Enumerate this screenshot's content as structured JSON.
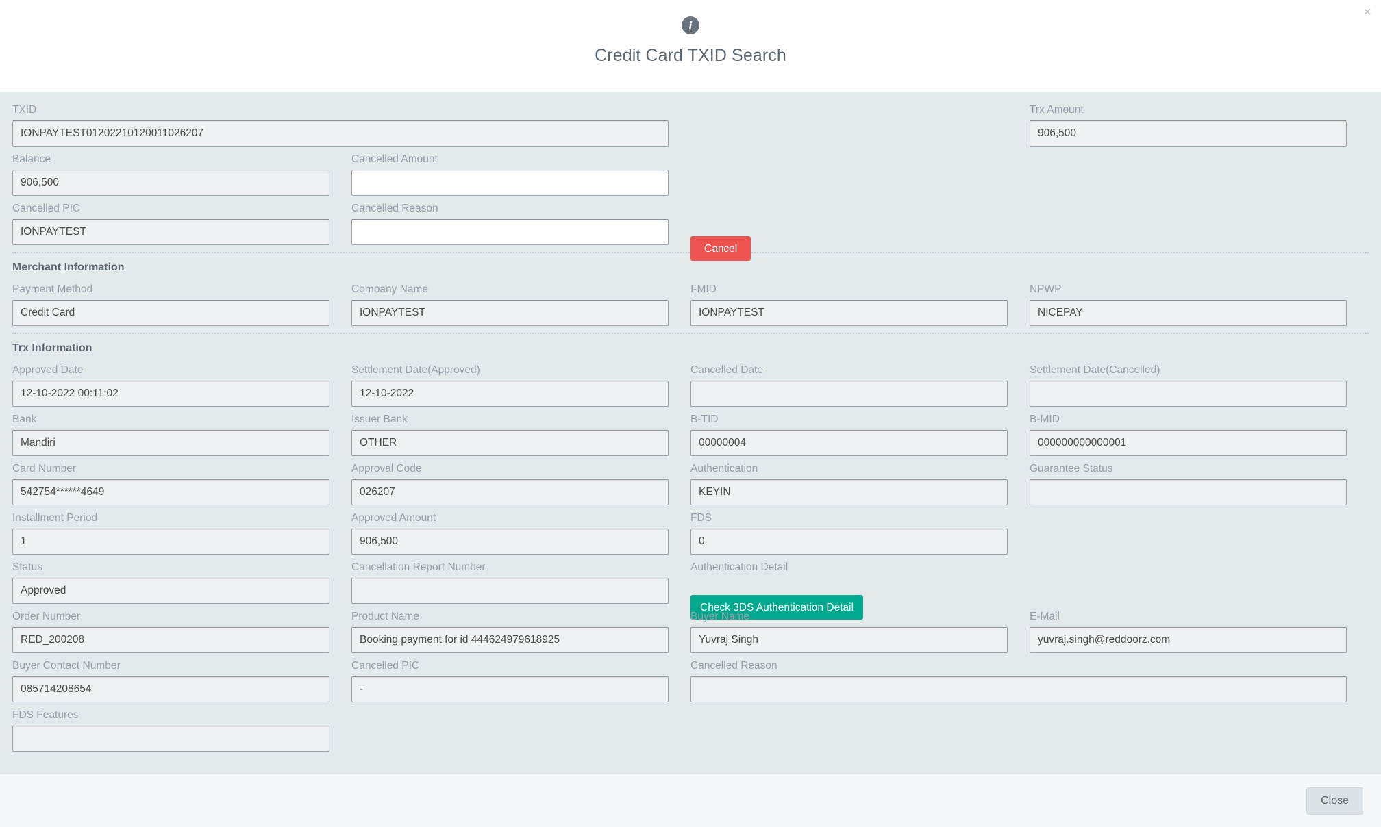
{
  "header": {
    "icon": "info-icon",
    "title": "Credit Card TXID Search",
    "close_x": "×"
  },
  "top_section": {
    "txid": {
      "label": "TXID",
      "value": "IONPAYTEST01202210120011026207",
      "editable": false
    },
    "trx_amount": {
      "label": "Trx Amount",
      "value": "906,500",
      "editable": false
    },
    "balance": {
      "label": "Balance",
      "value": "906,500",
      "editable": false
    },
    "cancelled_amount": {
      "label": "Cancelled Amount",
      "value": "",
      "editable": true
    },
    "cancelled_pic": {
      "label": "Cancelled PIC",
      "value": "IONPAYTEST",
      "editable": false
    },
    "cancelled_reason": {
      "label": "Cancelled Reason",
      "value": "",
      "editable": true
    },
    "cancel_button": "Cancel"
  },
  "merchant_information": {
    "title": "Merchant Information",
    "payment_method": {
      "label": "Payment Method",
      "value": "Credit Card"
    },
    "company_name": {
      "label": "Company Name",
      "value": "IONPAYTEST"
    },
    "i_mid": {
      "label": "I-MID",
      "value": "IONPAYTEST"
    },
    "npwp": {
      "label": "NPWP",
      "value": "NICEPAY"
    }
  },
  "trx_information": {
    "title": "Trx Information",
    "approved_date": {
      "label": "Approved Date",
      "value": "12-10-2022 00:11:02"
    },
    "settlement_date_approved": {
      "label": "Settlement Date(Approved)",
      "value": "12-10-2022"
    },
    "cancelled_date": {
      "label": "Cancelled Date",
      "value": ""
    },
    "settlement_date_cancelled": {
      "label": "Settlement Date(Cancelled)",
      "value": ""
    },
    "bank": {
      "label": "Bank",
      "value": "Mandiri"
    },
    "issuer_bank": {
      "label": "Issuer Bank",
      "value": "OTHER"
    },
    "b_tid": {
      "label": "B-TID",
      "value": "00000004"
    },
    "b_mid": {
      "label": "B-MID",
      "value": "000000000000001"
    },
    "card_number": {
      "label": "Card Number",
      "value": "542754******4649"
    },
    "approval_code": {
      "label": "Approval Code",
      "value": "026207"
    },
    "authentication": {
      "label": "Authentication",
      "value": "KEYIN"
    },
    "guarantee_status": {
      "label": "Guarantee Status",
      "value": ""
    },
    "installment_period": {
      "label": "Installment Period",
      "value": "1"
    },
    "approved_amount": {
      "label": "Approved Amount",
      "value": "906,500"
    },
    "fds": {
      "label": "FDS",
      "value": "0"
    },
    "status": {
      "label": "Status",
      "value": "Approved"
    },
    "cancellation_report_number": {
      "label": "Cancellation Report Number",
      "value": ""
    },
    "authentication_detail": {
      "label": "Authentication Detail",
      "button": "Check 3DS Authentication Detail"
    },
    "order_number": {
      "label": "Order Number",
      "value": "RED_200208"
    },
    "product_name": {
      "label": "Product Name",
      "value": "Booking payment for id 444624979618925"
    },
    "buyer_name": {
      "label": "Buyer Name",
      "value": "Yuvraj Singh"
    },
    "email": {
      "label": "E-Mail",
      "value": "yuvraj.singh@reddoorz.com"
    },
    "buyer_contact_number": {
      "label": "Buyer Contact Number",
      "value": "085714208654"
    },
    "cancelled_pic": {
      "label": "Cancelled PIC",
      "value": "-"
    },
    "cancelled_reason": {
      "label": "Cancelled Reason",
      "value": ""
    },
    "fds_features": {
      "label": "FDS Features",
      "value": ""
    }
  },
  "footer": {
    "close_label": "Close"
  },
  "colors": {
    "cancel_red": "#ef5350",
    "teal": "#00a88e",
    "body_bg": "#e4e9ec",
    "label_grey": "#94a0aa"
  }
}
